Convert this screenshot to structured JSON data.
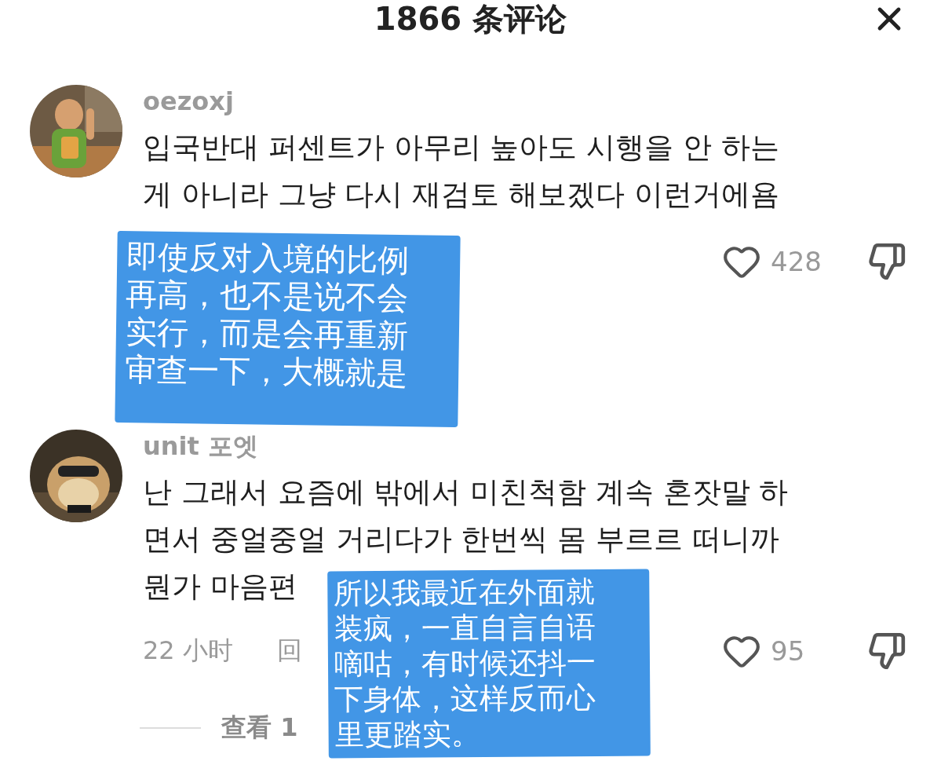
{
  "header": {
    "title": "1866 条评论"
  },
  "comments": [
    {
      "username": "oezoxj",
      "lines": [
        "입국반대 퍼센트가 아무리 높아도 시행을 안 하는",
        "게 아니라 그냥 다시 재검토 해보겠다 이런거에욤"
      ],
      "likes": "428"
    },
    {
      "username": "unit 포엣",
      "lines": [
        "난 그래서 요즘에 밖에서 미친척함 계속 혼잣말 하",
        "면서 중얼중얼 거리다가 한번씩 몸 부르르 떠니까",
        "뭔가 마음편"
      ],
      "time": "22 小时",
      "reply": "回",
      "likes": "95",
      "view_replies": "查看 1"
    }
  ],
  "translations": [
    {
      "lines": [
        "即使反对入境的比例",
        "再高，也不是说不会",
        "实行，而是会再重新",
        "审查一下，大概就是"
      ]
    },
    {
      "lines": [
        "所以我最近在外面就",
        "装疯，一直自言自语",
        "嘀咕，有时候还抖一",
        "下身体，这样反而心",
        "里更踏实。"
      ]
    }
  ]
}
